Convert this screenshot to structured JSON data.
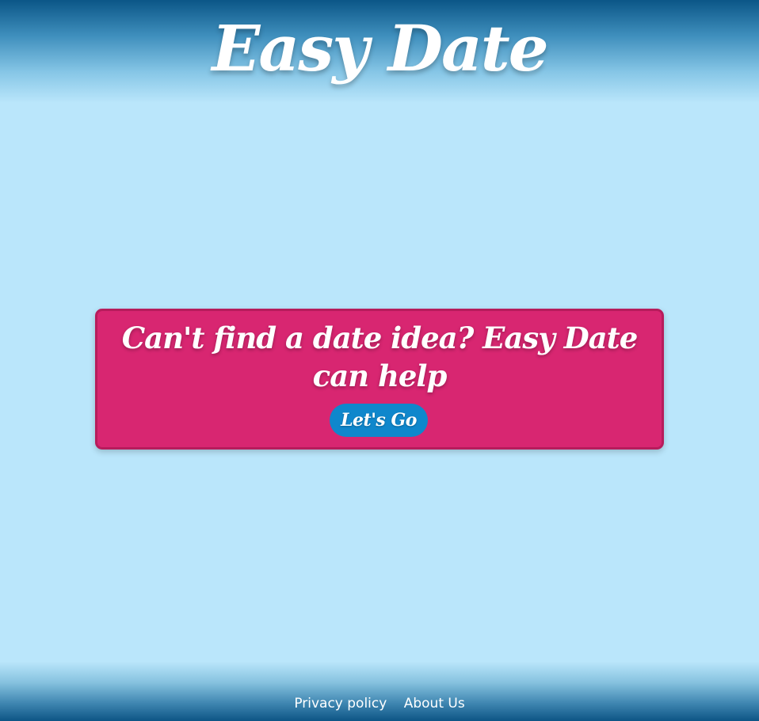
{
  "header": {
    "title": "Easy Date"
  },
  "hero": {
    "headline": "Can't find a date idea? Easy Date can help",
    "cta_label": "Let's Go"
  },
  "footer": {
    "links": [
      {
        "label": "Privacy policy"
      },
      {
        "label": "About Us"
      }
    ]
  },
  "colors": {
    "background": "#bae6fb",
    "header_dark": "#0b5687",
    "card_pink": "#d82671",
    "card_border": "#b71c5c",
    "button_blue": "#0f87cc"
  }
}
